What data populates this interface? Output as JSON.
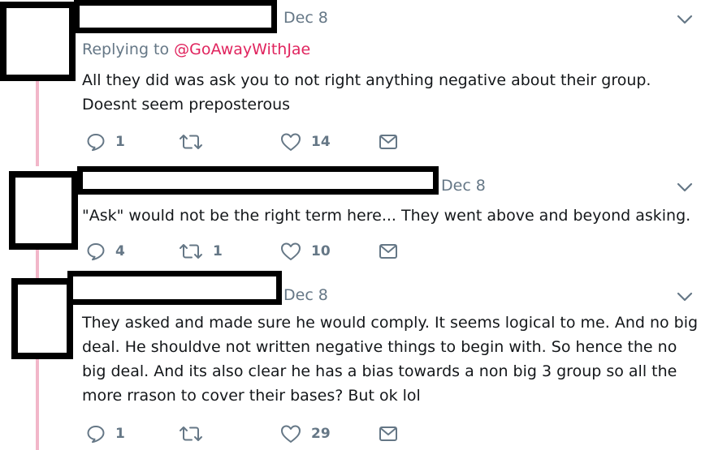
{
  "tweets": [
    {
      "date": "Dec 8",
      "replying_prefix": "Replying to",
      "replying_handle": "@GoAwayWithJae",
      "text": "All they did was ask you to not right anything negative about their group. Doesnt seem preposterous",
      "replies": "1",
      "retweets": "",
      "likes": "14"
    },
    {
      "date": "Dec 8",
      "text": "\"Ask\" would not be the right term here... They went above and beyond asking.",
      "replies": "4",
      "retweets": "1",
      "likes": "10"
    },
    {
      "date": "Dec 8",
      "text": "They asked and made sure he would comply. It seems logical to me. And no big deal. He shouldve not written negative things to begin with. So hence the no big deal. And its also clear he has a bias towards a non big 3 group so all the more rrason to cover their bases? But ok lol",
      "replies": "1",
      "retweets": "",
      "likes": "29"
    }
  ],
  "icons": [
    "reply-icon",
    "retweet-icon",
    "like-icon",
    "message-icon",
    "chevron-down-icon"
  ],
  "colors": {
    "mention": "#e0245e",
    "muted": "#657786",
    "thread_line": "#f2b6c9"
  }
}
